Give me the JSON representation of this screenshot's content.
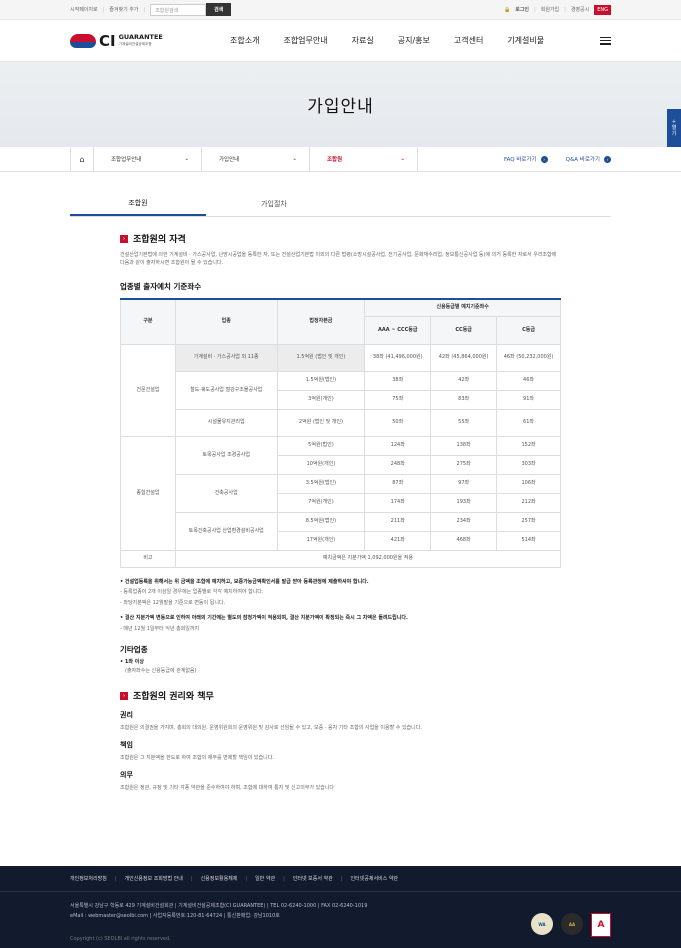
{
  "topbar": {
    "set_home": "시작페이지로",
    "add_favorite": "즐겨찾기 추가",
    "search_placeholder": "조합원검색",
    "search_button": "검색",
    "login": "로그인",
    "signup": "회원가입",
    "intranet": "경영공시",
    "eng": "ENG"
  },
  "logo": {
    "ci": "CI",
    "en": "GUARANTEE",
    "ko": "기계설비건설공제조합"
  },
  "gnb": [
    "조합소개",
    "조합업무안내",
    "자료실",
    "공지/홍보",
    "고객센터",
    "기계설비물"
  ],
  "hero": {
    "title": "가입안내"
  },
  "side_tab": {
    "line1": "+",
    "line2": "열",
    "line3": "기"
  },
  "location": {
    "items": [
      "조합업무안내",
      "가입안내",
      "조합원"
    ],
    "faq": "FAQ 바로가기",
    "qna": "Q&A 바로가기"
  },
  "tabs": [
    "조합원",
    "가입절차"
  ],
  "qualification": {
    "title": "조합원의 자격",
    "text": "건설산업기본법에 의한 기계설비 · 가스공사업, 난방시공업을 등록한 자, 또는 건설산업기본법 이외의 다른 법령(소방시설공사업, 전기공사업, 문화재수리업, 정보통신공사업 등)에 의거 등록한 자로서 우리조합에 다음과 같이 출자하시면 조합원이 될 수 있습니다."
  },
  "table": {
    "title": "업종별 출자예치 기준좌수",
    "headers": {
      "col1": "구분",
      "col2": "업종",
      "col3": "법정자본금",
      "group": "신용등급별 예치기준좌수",
      "g1": "AAA ~ CCC등급",
      "g2": "CC등급",
      "g3": "C등급"
    },
    "cat1": "건문건설업",
    "cat2": "종합건설업",
    "r1": {
      "biz": "기계설비 · 가스공사업 외 11종",
      "cap": "1.5억원 (법인 및 개인)",
      "a": "38좌 (41,496,000원)",
      "b": "42좌 (45,864,000원)",
      "c": "46좌 (50,232,000원)"
    },
    "biz2": "철도·궤도공사업 철강구조물공사업",
    "r2": {
      "cap": "1.5억원(법인)",
      "a": "38좌",
      "b": "42좌",
      "c": "46좌"
    },
    "r3": {
      "cap": "3억원(개인)",
      "a": "75좌",
      "b": "83좌",
      "c": "91좌"
    },
    "r4": {
      "biz": "시설물유지관리업",
      "cap": "2억원 (법인 및 개인)",
      "a": "50좌",
      "b": "55좌",
      "c": "61좌"
    },
    "biz5": "토목공사업 조경공사업",
    "r5": {
      "cap": "5억원(법인)",
      "a": "124좌",
      "b": "138좌",
      "c": "152좌"
    },
    "r6": {
      "cap": "10억원(개인)",
      "a": "248좌",
      "b": "275좌",
      "c": "303좌"
    },
    "biz7": "건축공사업",
    "r7": {
      "cap": "3.5억원(법인)",
      "a": "87좌",
      "b": "97좌",
      "c": "106좌"
    },
    "r8": {
      "cap": "7억원(개인)",
      "a": "174좌",
      "b": "193좌",
      "c": "212좌"
    },
    "biz9": "토목건축공사업 산업환경설비공사업",
    "r9": {
      "cap": "8.5억원(법인)",
      "a": "211좌",
      "b": "234좌",
      "c": "257좌"
    },
    "r10": {
      "cap": "17억원(개인)",
      "a": "421좌",
      "b": "468좌",
      "c": "514좌"
    },
    "note_label": "비고",
    "note_text": "예치금액은 지분가액 1,092,000원을 적용"
  },
  "notes": {
    "n1": "• 건설업등록을 위해서는 위 금액을 조합에 예치하고, 보증가능금액확인서를 발급 받아 등록관청에 제출하셔야 합니다.",
    "n2": "- 등록업종이 2개 이상일 경우에는 업종별로 각각 예치하여야 합니다.",
    "n3": "- 좌당지분액은 12월말을 기준으로 변동이 됩니다.",
    "n4": "• 결산 지분가액 변동으로 인하여 아래의 기간에는 별도의 잠정가액이 적용되며, 결산 지분가액이 확정되는 즉시 그 차액은 돌려드립니다.",
    "n5": "- 매년 12월 1일부터 익년 총회일까지"
  },
  "other": {
    "title": "기타업종",
    "l1": "• 1좌 이상",
    "l2": "(출자좌수는 신용등급에 관계없음)"
  },
  "rights": {
    "title": "조합원의 권리와 책무",
    "right_title": "권리",
    "right_text": "조합원은 의결권을 가지며, 총회의 대의원, 운영위원회의 운영위원 및 감사로 선임될 수 있고, 보증 · 융자 기타 조합의 사업을 이용할 수 있습니다.",
    "resp_title": "책임",
    "resp_text": "조합원은 그 지분액을 한도로 하여 조합의 채무를 변제할 책임이 있습니다.",
    "duty_title": "의무",
    "duty_text": "조합원은 정관, 규정 및 기타 각종 약관을 준수하여야 하며, 조합에 대하여 통지 및 신고의무가 있습니다"
  },
  "footer": {
    "links": [
      "개인정보처리방침",
      "개인신용정보 조회방법 안내",
      "신용정보활용체제",
      "일반 약관",
      "인터넷 보증서 약관",
      "인터넷공제서비스 약관"
    ],
    "addr": "서울특별시 강남구 학동로 429 기계설비건설회관  |  기계설비건설공제조합(CI GUARANTEE)  |  TEL 02-6240-1000  |  FAX 02-6240-1019",
    "email": "eMail : webmaster@seolbi.com  |  사업자등록번호:120-81-64724  |  통신판매업: 강남1010호",
    "copy": "Copyright (c) SEOLBI all rights reserved.",
    "badge1": "WA",
    "badge2": "AA",
    "badge3": "A"
  }
}
